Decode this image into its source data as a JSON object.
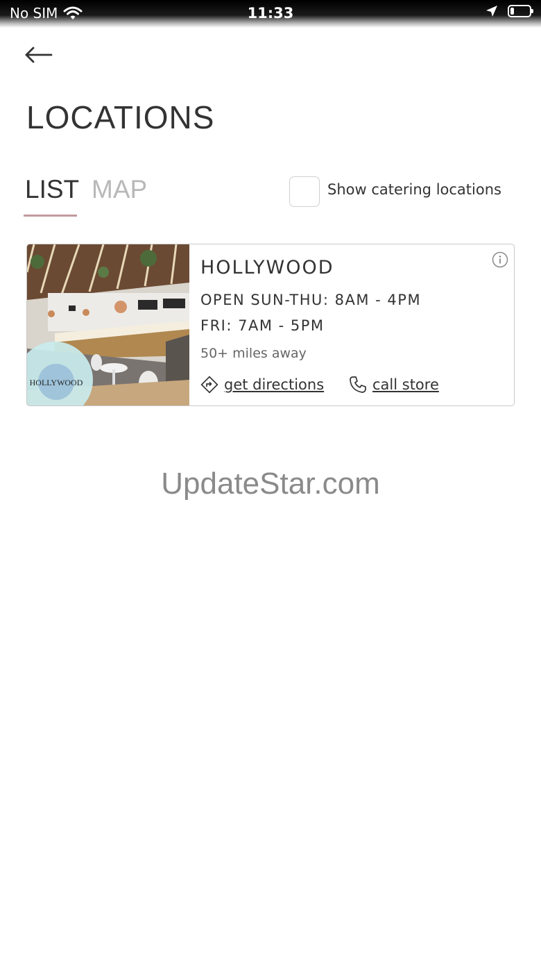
{
  "status_bar": {
    "carrier": "No SIM",
    "time": "11:33",
    "battery_level": 0.2,
    "icons": [
      "wifi-icon",
      "location-arrow-icon",
      "battery-icon"
    ]
  },
  "header": {
    "back_icon": "arrow-left-icon",
    "title": "LOCATIONS"
  },
  "tabs": [
    {
      "label": "LIST",
      "active": true
    },
    {
      "label": "MAP",
      "active": false
    }
  ],
  "catering_filter": {
    "label": "Show catering locations",
    "checked": false
  },
  "locations": [
    {
      "name": "HOLLYWOOD",
      "hours": [
        "OPEN SUN-THU: 8AM - 4PM",
        "FRI: 7AM - 5PM"
      ],
      "distance": "50+ miles away",
      "photo_logo_text": "HOLLYWOOD",
      "actions": {
        "directions_label": "get directions",
        "call_label": "call store"
      }
    }
  ],
  "watermark": "UpdateStar.com",
  "colors": {
    "tab_underline": "#c29a9e",
    "text_primary": "#333333",
    "tab_inactive": "#b8b8b8",
    "card_border": "#c8c8c8"
  }
}
